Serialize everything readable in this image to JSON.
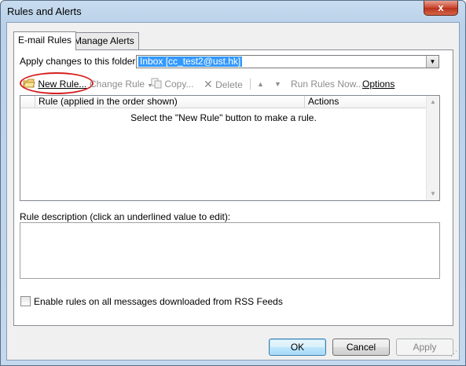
{
  "window": {
    "title": "Rules and Alerts",
    "close_glyph": "x"
  },
  "tabs": [
    {
      "label": "E-mail Rules"
    },
    {
      "label": "Manage Alerts"
    }
  ],
  "folder": {
    "label": "Apply changes to this folder:",
    "value": "Inbox [cc_test2@ust.hk]"
  },
  "toolbar": {
    "new_rule": "New Rule...",
    "change_rule": "Change Rule",
    "copy": "Copy...",
    "delete": "Delete",
    "run_rules_now": "Run Rules Now...",
    "options": "Options"
  },
  "rules_list": {
    "columns": [
      "Rule (applied in the order shown)",
      "Actions"
    ],
    "empty_message": "Select the \"New Rule\" button to make a rule."
  },
  "description": {
    "label": "Rule description (click an underlined value to edit):"
  },
  "rss": {
    "label": "Enable rules on all messages downloaded from RSS Feeds",
    "checked": false
  },
  "buttons": {
    "ok": "OK",
    "cancel": "Cancel",
    "apply": "Apply"
  },
  "colors": {
    "highlight": "#3399ff",
    "annotation_circle": "#d62020",
    "close_button": "#c7452f"
  }
}
